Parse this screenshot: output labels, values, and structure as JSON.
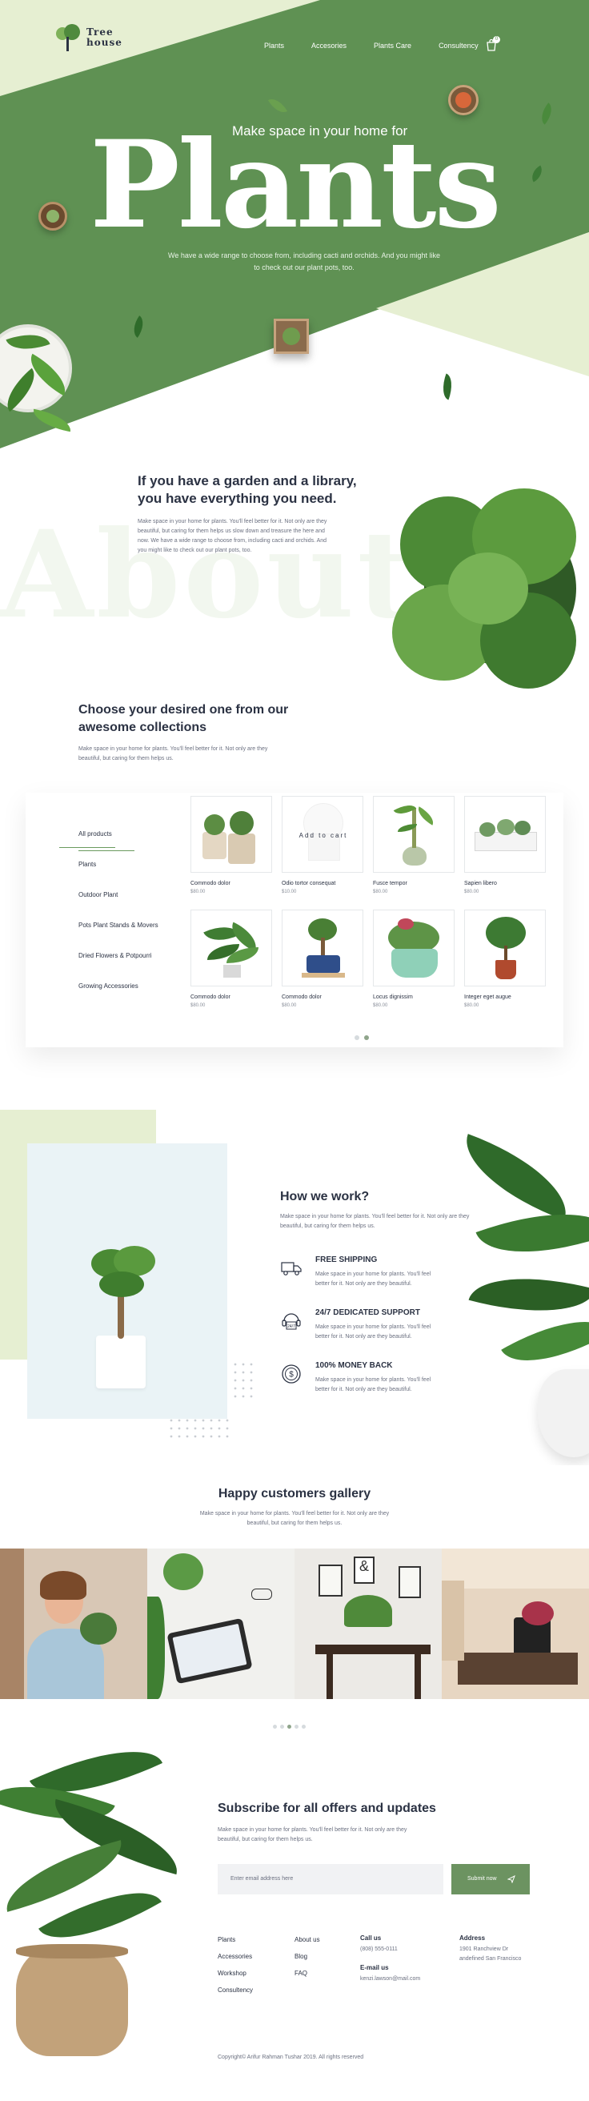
{
  "header": {
    "logo_line1": "Tree",
    "logo_line2": "house",
    "nav": [
      "Plants",
      "Accesories",
      "Plants Care",
      "Consultency"
    ],
    "cart_badge": "0"
  },
  "hero": {
    "subtitle": "Make space in your home for",
    "title": "Plants",
    "desc_line1": "We have a wide range to choose from, including cacti and orchids. And you might like",
    "desc_line2": "to check out our plant pots, too."
  },
  "about": {
    "bg_word": "About",
    "title_line1": "If you have a garden and a library,",
    "title_line2": "you have everything you need.",
    "text": [
      "Make space in your home for plants. You'll feel better for it. Not only are they",
      "beautiful, but caring for them helps us slow down and treasure the here and",
      "now. We have a wide range to choose from, including cacti and orchids. And",
      "you might like to check out our plant pots, too."
    ]
  },
  "collections": {
    "title_line1": "Choose your desired one from our",
    "title_line2": "awesome collections",
    "text": [
      "Make space in your home for plants. You'll feel better for it. Not only are they",
      "beautiful, but caring for them helps us."
    ],
    "categories": [
      "All products",
      "Plants",
      "Outdoor Plant",
      "Pots Plant Stands & Movers",
      "Dried Flowers & Potpourri",
      "Growing Accessories"
    ],
    "add_to_cart": "Add to cart",
    "products": [
      {
        "name": "Commodo dolor",
        "price": "$80.00"
      },
      {
        "name": "Odio tortor consequat",
        "price": "$10.00"
      },
      {
        "name": "Fusce tempor",
        "price": "$80.00"
      },
      {
        "name": "Sapien libero",
        "price": "$80.00"
      },
      {
        "name": "Commodo dolor",
        "price": "$80.00"
      },
      {
        "name": "Commodo dolor",
        "price": "$80.00"
      },
      {
        "name": "Locus dignissim",
        "price": "$80.00"
      },
      {
        "name": "Integer eget augue",
        "price": "$80.00"
      }
    ]
  },
  "how": {
    "title": "How we work?",
    "text": [
      "Make space in your home for plants. You'll feel better for it. Not only are they",
      "beautiful, but caring for them helps us."
    ],
    "features": [
      {
        "icon": "truck-icon",
        "title": "FREE SHIPPING",
        "l1": "Make space in your home for plants. You'll feel",
        "l2": "better for it. Not only are they beautiful."
      },
      {
        "icon": "support-24-7-icon",
        "title": "24/7 DEDICATED SUPPORT",
        "l1": "Make space in your home for plants. You'll feel",
        "l2": "better for it. Not only are they beautiful."
      },
      {
        "icon": "money-back-icon",
        "title": "100% MONEY BACK",
        "l1": "Make space in your home for plants. You'll feel",
        "l2": "better for it. Not only are they beautiful."
      }
    ]
  },
  "gallery": {
    "title": "Happy customers gallery",
    "text_line1": "Make space in your home for plants. You'll feel better for it. Not only are they",
    "text_line2": "beautiful, but caring for them helps us."
  },
  "subscribe": {
    "title": "Subscribe for all offers and updates",
    "text_line1": "Make space in your home for plants. You'll feel better for it. Not only are they",
    "text_line2": "beautiful, but caring for them helps us.",
    "placeholder": "Enter email address here",
    "button": "Submit now"
  },
  "footer": {
    "col1": [
      "Plants",
      "Accessories",
      "Workshop",
      "Consultency"
    ],
    "col2": [
      "About us",
      "Blog",
      "FAQ"
    ],
    "call_head": "Call us",
    "call_value": "(808) 555-0111",
    "email_head": "E-mail us",
    "email_value": "kenzi.lawson@mail.com",
    "address_head": "Address",
    "address_line1": "1901 Ranchview Dr",
    "address_line2": "andefined San Francisco",
    "copyright": "Copyright© Arifur Rahman Tushar 2019. All rights reserved"
  },
  "colors": {
    "primary_green": "#5f9153",
    "light_green": "#e6efd2",
    "dark_text": "#2b3243",
    "button_green": "#6c9361"
  }
}
